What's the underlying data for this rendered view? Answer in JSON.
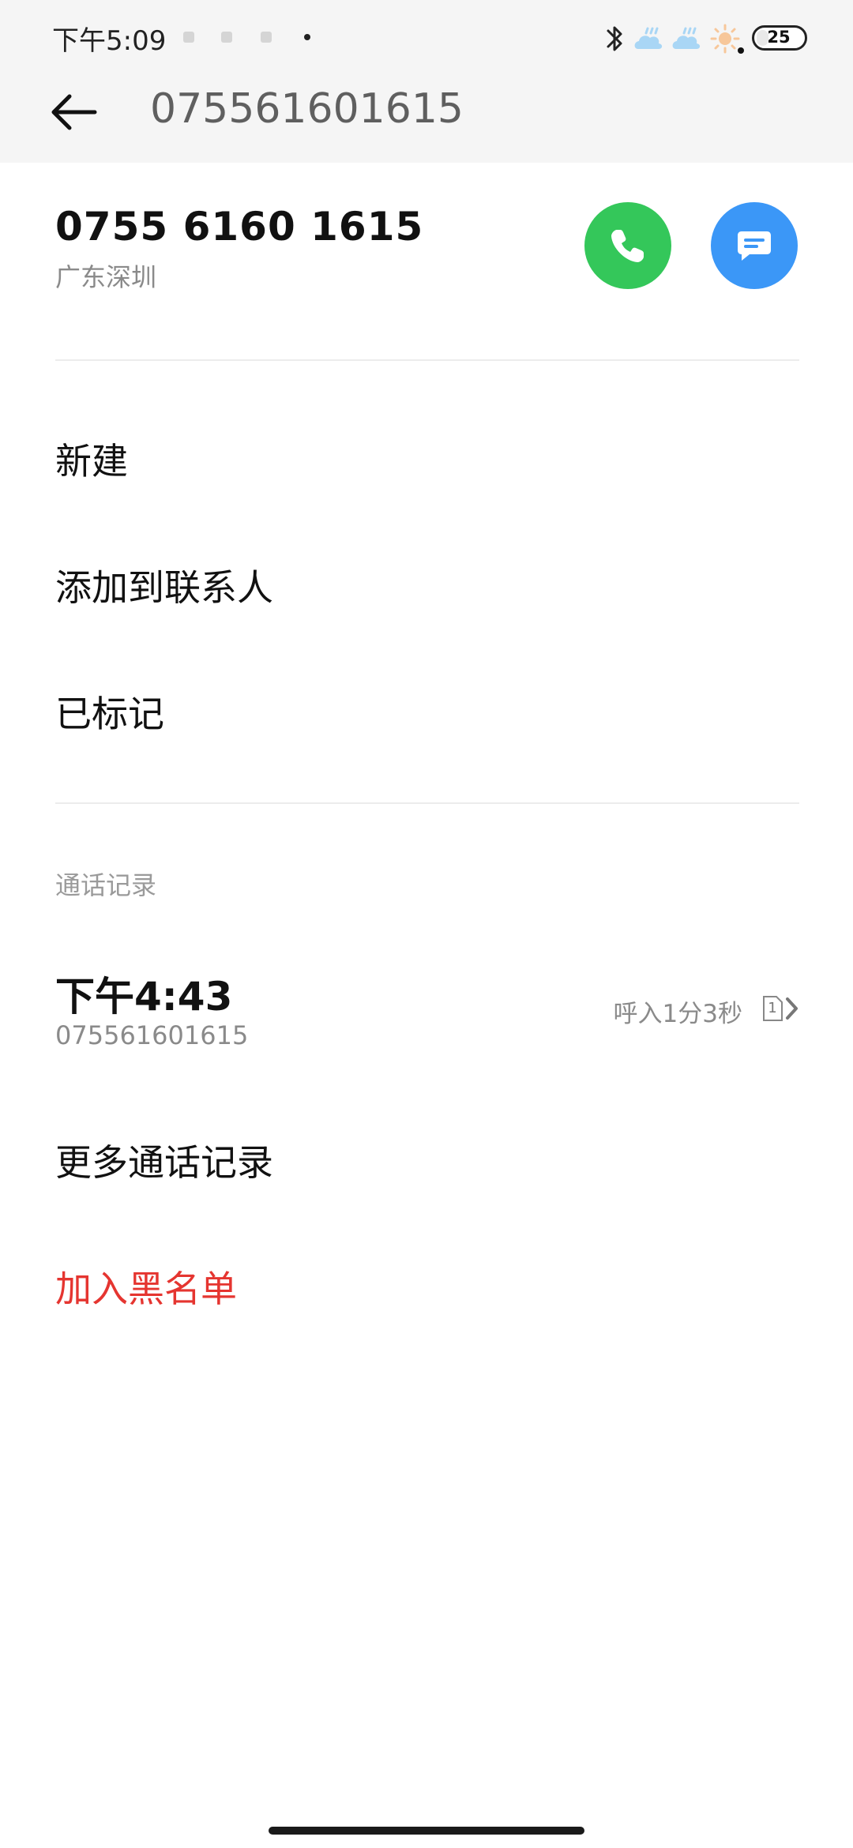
{
  "status_bar": {
    "time": "下午5:09",
    "battery_level": 25,
    "battery_label": "25"
  },
  "header": {
    "title": "075561601615"
  },
  "contact": {
    "number_formatted": "0755 6160 1615",
    "location": "广东深圳"
  },
  "menu": {
    "new_label": "新建",
    "add_to_contacts_label": "添加到联系人",
    "marked_label": "已标记"
  },
  "call_log": {
    "section_label": "通话记录",
    "entries": [
      {
        "time": "下午4:43",
        "number": "075561601615",
        "detail": "呼入1分3秒",
        "sim": "1"
      }
    ],
    "more_label": "更多通话记录"
  },
  "actions": {
    "blacklist_label": "加入黑名单"
  },
  "colors": {
    "call_button": "#34c75a",
    "message_button": "#3b97f7",
    "danger_text": "#e53530"
  }
}
